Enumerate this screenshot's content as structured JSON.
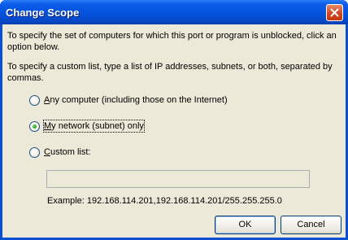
{
  "window": {
    "title": "Change Scope"
  },
  "intro": {
    "line1": "To specify the set of computers for which this port or program is unblocked, click an option below.",
    "line2": "To specify a custom list, type a list of IP addresses, subnets, or both, separated by commas."
  },
  "options": {
    "any": {
      "mnemonic": "A",
      "rest": "ny computer (including those on the Internet)",
      "selected": false
    },
    "network": {
      "mnemonic": "M",
      "rest": "y network (subnet) only",
      "selected": true
    },
    "custom": {
      "mnemonic": "C",
      "rest": "ustom list:",
      "selected": false
    }
  },
  "custom_list": {
    "value": ""
  },
  "example": "Example: 192.168.114.201,192.168.114.201/255.255.255.0",
  "buttons": {
    "ok": "OK",
    "cancel": "Cancel"
  },
  "colors": {
    "title_bar": "#0552dc",
    "dialog_bg": "#ece9d8",
    "close_button": "#d3461e",
    "radio_selected": "#21a121"
  },
  "icons": {
    "close": "close-icon"
  }
}
